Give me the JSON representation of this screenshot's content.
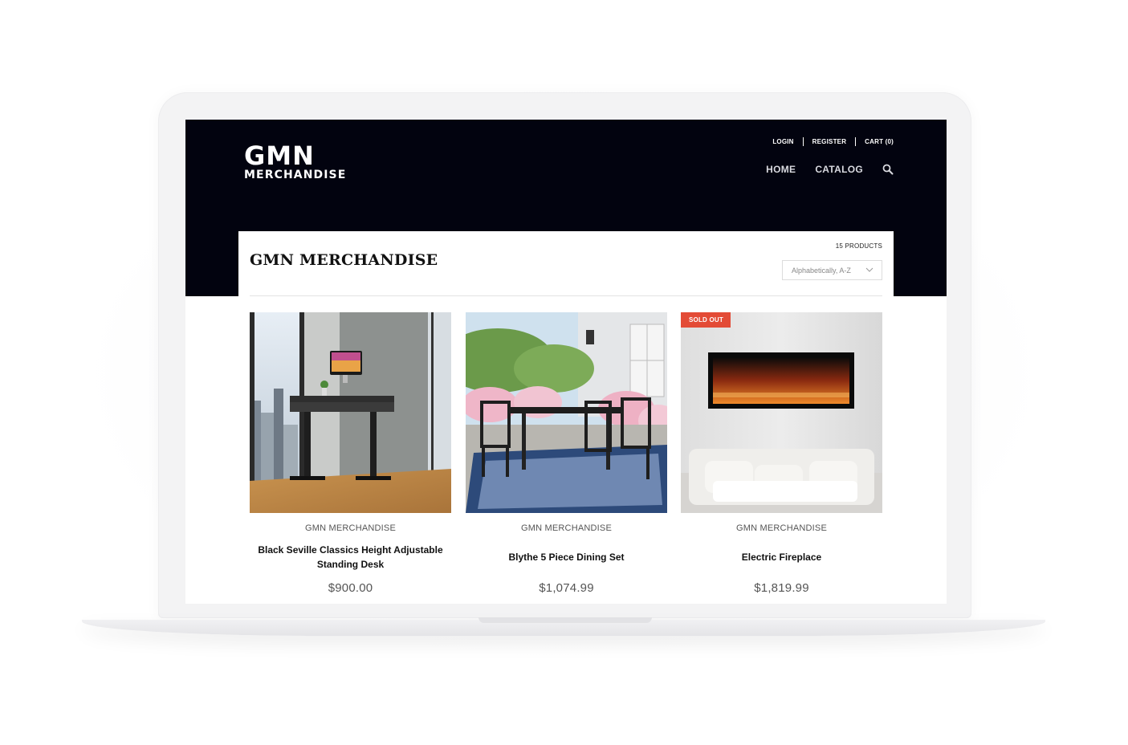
{
  "brand": {
    "line1": "GMN",
    "line2": "MERCHANDISE"
  },
  "util_nav": {
    "login": "LOGIN",
    "register": "REGISTER",
    "cart": "CART (0)"
  },
  "main_nav": {
    "home": "HOME",
    "catalog": "CATALOG",
    "search_icon": "search-icon"
  },
  "collection": {
    "title": "GMN MERCHANDISE",
    "count": "15 PRODUCTS",
    "sort_selected": "Alphabetically, A-Z"
  },
  "products": [
    {
      "vendor": "GMN MERCHANDISE",
      "name": "Black Seville Classics Height Adjustable Standing Desk",
      "price": "$900.00",
      "badge": ""
    },
    {
      "vendor": "GMN MERCHANDISE",
      "name": "Blythe 5 Piece Dining Set",
      "price": "$1,074.99",
      "badge": ""
    },
    {
      "vendor": "GMN MERCHANDISE",
      "name": "Electric Fireplace",
      "price": "$1,819.99",
      "badge": "SOLD OUT"
    }
  ],
  "colors": {
    "header_bg": "#02030f",
    "badge": "#e34b36"
  }
}
